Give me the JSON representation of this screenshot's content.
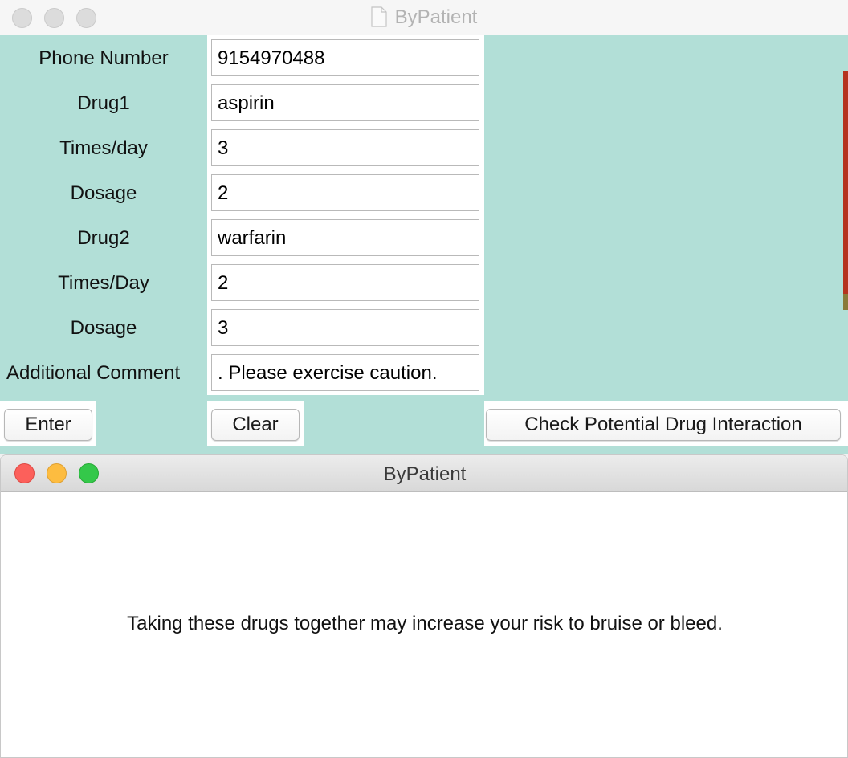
{
  "window1": {
    "title": "ByPatient",
    "form": {
      "rows": [
        {
          "label": "Phone Number",
          "value": "9154970488"
        },
        {
          "label": "Drug1",
          "value": "aspirin"
        },
        {
          "label": "Times/day",
          "value": "3"
        },
        {
          "label": "Dosage",
          "value": "2"
        },
        {
          "label": "Drug2",
          "value": "warfarin"
        },
        {
          "label": "Times/Day",
          "value": "2"
        },
        {
          "label": "Dosage",
          "value": "3"
        },
        {
          "label": "Additional Comment",
          "value": ". Please exercise caution."
        }
      ]
    },
    "buttons": {
      "enter": "Enter",
      "clear": "Clear",
      "check": "Check Potential Drug Interaction"
    },
    "colors": {
      "form_background": "#b2dfd7"
    }
  },
  "window2": {
    "title": "ByPatient",
    "message": "Taking these drugs together may increase your risk to bruise or bleed."
  }
}
